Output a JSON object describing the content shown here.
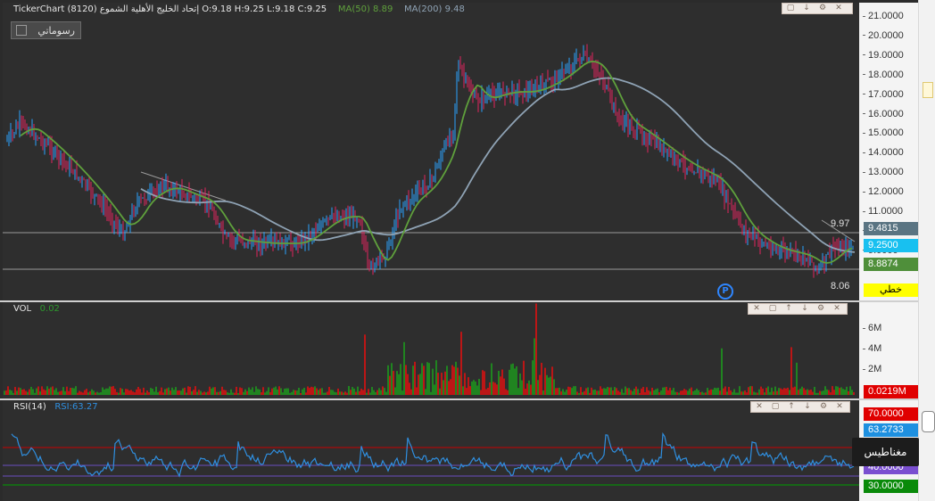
{
  "app": {
    "name": "TickerChart"
  },
  "header": {
    "symbol_line": "TickerChart إتحاد الخليج الأهلية الشموع (8120) O:9.18  H:9.25  L:9.18  C:9.25",
    "ma50_label": "MA(50)",
    "ma50_value": "8.89",
    "ma200_label": "MA(200)",
    "ma200_value": "9.48"
  },
  "drawing_button": {
    "label": "رسوماتي"
  },
  "price_axis": {
    "ticks": [
      "21.0000",
      "20.0000",
      "19.0000",
      "18.0000",
      "17.0000",
      "16.0000",
      "15.0000",
      "14.0000",
      "13.0000",
      "12.0000",
      "11.0000",
      "10.0000",
      "9.0000"
    ],
    "tags": {
      "ma200": "9.4815",
      "close": "9.2500",
      "ma50": "8.8874",
      "line_type": "خطي"
    }
  },
  "chart_annotations": {
    "upper_line_label": "9.97",
    "lower_line_label": "8.06",
    "badge": "P"
  },
  "volume": {
    "label": "VOL",
    "value": "0.02",
    "ticks": [
      "6M",
      "4M",
      "2M"
    ],
    "tag": "0.0219M"
  },
  "rsi": {
    "label": "RSI(14)",
    "value_label": "RSI:63.27",
    "tags": {
      "upper": "70.0000",
      "current": "63.2733",
      "mid": "40.0000",
      "lower": "30.0000"
    }
  },
  "tooltip": {
    "text": "مغناطيس"
  },
  "colors": {
    "background": "#2e2e2e",
    "up_candle": "#29a3ff",
    "down_candle": "#e0245e",
    "ma50": "#5fa03c",
    "ma200": "#8fa3b5",
    "vol_up": "#1e9a1e",
    "vol_down": "#e01010",
    "rsi_line": "#2f8fe0",
    "rsi_upper": "#c80000",
    "rsi_lower": "#00a000",
    "tag_ma200": "#5a7482",
    "tag_close": "#18c0f0",
    "tag_ma50": "#4f8f3a",
    "tag_type": "#ffff00",
    "tag_vol": "#e00000",
    "tag_rsi_upper": "#e00000",
    "tag_rsi_current": "#1e90e0",
    "tag_rsi_mid": "#7a4fd0",
    "tag_rsi_lower": "#0a8a0a"
  },
  "icons": [
    "window-icon",
    "arrow-down-icon",
    "settings-icon",
    "close-icon",
    "arrow-up-icon",
    "pencil-icon"
  ]
}
